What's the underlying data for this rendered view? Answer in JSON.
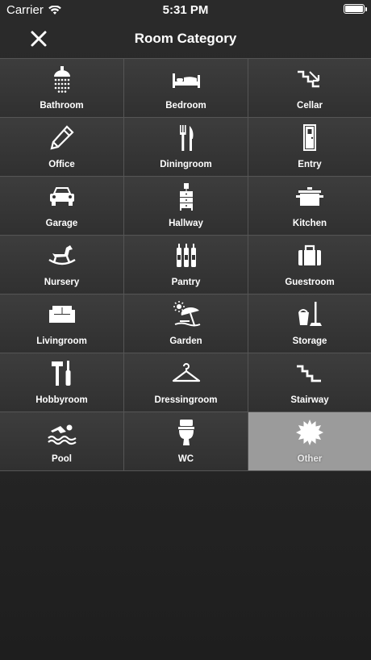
{
  "status_bar": {
    "carrier": "Carrier",
    "time": "5:31 PM"
  },
  "navbar": {
    "title": "Room Category"
  },
  "categories": [
    {
      "label": "Bathroom",
      "icon": "shower-icon"
    },
    {
      "label": "Bedroom",
      "icon": "bed-icon"
    },
    {
      "label": "Cellar",
      "icon": "stairs-down-icon"
    },
    {
      "label": "Office",
      "icon": "pencil-icon"
    },
    {
      "label": "Diningroom",
      "icon": "fork-knife-icon"
    },
    {
      "label": "Entry",
      "icon": "door-icon"
    },
    {
      "label": "Garage",
      "icon": "car-icon"
    },
    {
      "label": "Hallway",
      "icon": "cabinet-icon"
    },
    {
      "label": "Kitchen",
      "icon": "pot-icon"
    },
    {
      "label": "Nursery",
      "icon": "rocking-horse-icon"
    },
    {
      "label": "Pantry",
      "icon": "bottles-icon"
    },
    {
      "label": "Guestroom",
      "icon": "suitcase-icon"
    },
    {
      "label": "Livingroom",
      "icon": "sofa-icon"
    },
    {
      "label": "Garden",
      "icon": "umbrella-sun-icon"
    },
    {
      "label": "Storage",
      "icon": "bucket-mop-icon"
    },
    {
      "label": "Hobbyroom",
      "icon": "tools-icon"
    },
    {
      "label": "Dressingroom",
      "icon": "hanger-icon"
    },
    {
      "label": "Stairway",
      "icon": "stairs-icon"
    },
    {
      "label": "Pool",
      "icon": "swimmer-icon"
    },
    {
      "label": "WC",
      "icon": "toilet-icon"
    },
    {
      "label": "Other",
      "icon": "starburst-icon",
      "selected": true
    }
  ],
  "colors": {
    "selected_cell": "#9b9b9b",
    "cell": "#363636",
    "border": "#555555"
  }
}
